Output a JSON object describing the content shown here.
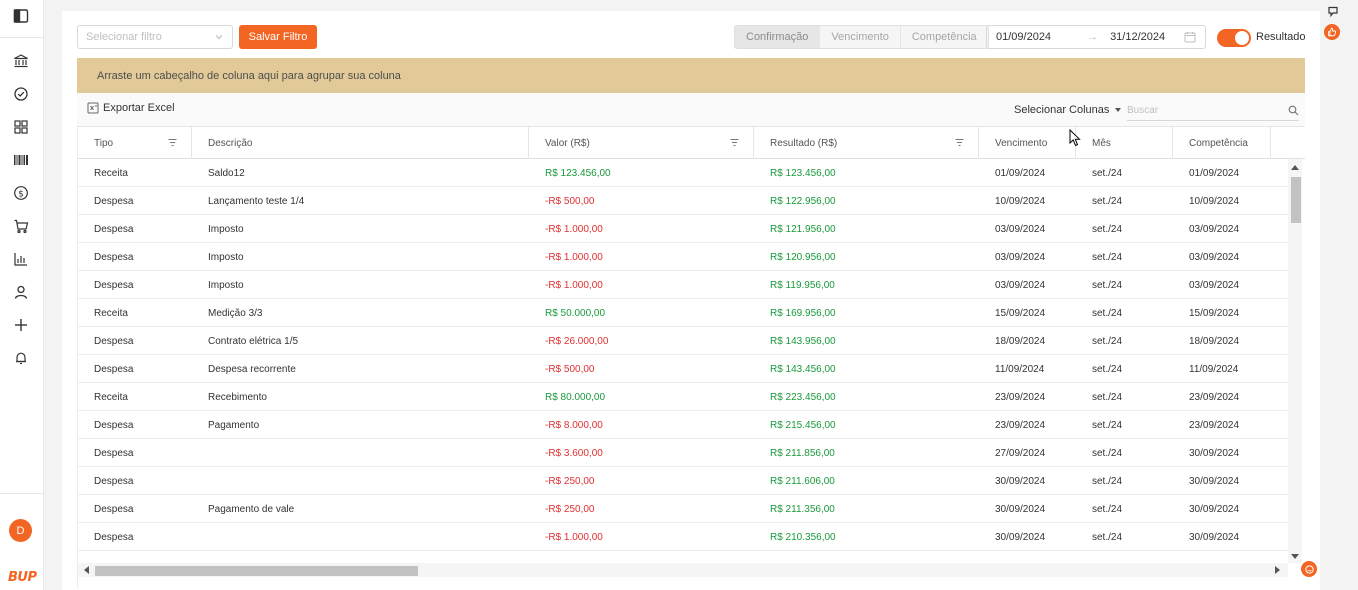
{
  "sidebar": {
    "items": [
      {
        "icon": "panel-toggle-icon"
      },
      {
        "icon": "bank-icon"
      },
      {
        "icon": "check-circle-icon"
      },
      {
        "icon": "grid-icon"
      },
      {
        "icon": "barcode-icon"
      },
      {
        "icon": "dollar-circle-icon"
      },
      {
        "icon": "cart-icon"
      },
      {
        "icon": "bar-chart-icon"
      },
      {
        "icon": "user-icon"
      },
      {
        "icon": "plus-icon"
      },
      {
        "icon": "bell-icon"
      }
    ],
    "avatar_letter": "D",
    "logo_text": "BUP"
  },
  "toolbar": {
    "filter_placeholder": "Selecionar filtro",
    "save_filter_label": "Salvar Filtro",
    "date_modes": [
      "Confirmação",
      "Vencimento",
      "Competência"
    ],
    "active_date_mode": "Confirmação",
    "date_start": "01/09/2024",
    "date_end": "31/12/2024",
    "result_toggle_label": "Resultado",
    "result_toggle_on": true
  },
  "group_panel": {
    "text": "Arraste um cabeçalho de coluna aqui para agrupar sua coluna"
  },
  "grid_toolbar": {
    "export_label": "Exportar Excel",
    "columns_label": "Selecionar Colunas",
    "search_placeholder": "Buscar"
  },
  "grid": {
    "columns": [
      "Tipo",
      "Descrição",
      "Valor (R$)",
      "Resultado (R$)",
      "Vencimento",
      "Mês",
      "Competência"
    ],
    "rows": [
      {
        "tipo": "Receita",
        "descricao": "Saldo12",
        "valor": "R$ 123.456,00",
        "valor_sign": "pos",
        "resultado": "R$ 123.456,00",
        "vencimento": "01/09/2024",
        "mes": "set./24",
        "competencia": "01/09/2024"
      },
      {
        "tipo": "Despesa",
        "descricao": "Lançamento teste 1/4",
        "valor": "-R$ 500,00",
        "valor_sign": "neg",
        "resultado": "R$ 122.956,00",
        "vencimento": "10/09/2024",
        "mes": "set./24",
        "competencia": "10/09/2024"
      },
      {
        "tipo": "Despesa",
        "descricao": "Imposto",
        "valor": "-R$ 1.000,00",
        "valor_sign": "neg",
        "resultado": "R$ 121.956,00",
        "vencimento": "03/09/2024",
        "mes": "set./24",
        "competencia": "03/09/2024"
      },
      {
        "tipo": "Despesa",
        "descricao": "Imposto",
        "valor": "-R$ 1.000,00",
        "valor_sign": "neg",
        "resultado": "R$ 120.956,00",
        "vencimento": "03/09/2024",
        "mes": "set./24",
        "competencia": "03/09/2024"
      },
      {
        "tipo": "Despesa",
        "descricao": "Imposto",
        "valor": "-R$ 1.000,00",
        "valor_sign": "neg",
        "resultado": "R$ 119.956,00",
        "vencimento": "03/09/2024",
        "mes": "set./24",
        "competencia": "03/09/2024"
      },
      {
        "tipo": "Receita",
        "descricao": "Medição 3/3",
        "valor": "R$ 50.000,00",
        "valor_sign": "pos",
        "resultado": "R$ 169.956,00",
        "vencimento": "15/09/2024",
        "mes": "set./24",
        "competencia": "15/09/2024"
      },
      {
        "tipo": "Despesa",
        "descricao": "Contrato elétrica 1/5",
        "valor": "-R$ 26.000,00",
        "valor_sign": "neg",
        "resultado": "R$ 143.956,00",
        "vencimento": "18/09/2024",
        "mes": "set./24",
        "competencia": "18/09/2024"
      },
      {
        "tipo": "Despesa",
        "descricao": "Despesa recorrente",
        "valor": "-R$ 500,00",
        "valor_sign": "neg",
        "resultado": "R$ 143.456,00",
        "vencimento": "11/09/2024",
        "mes": "set./24",
        "competencia": "11/09/2024"
      },
      {
        "tipo": "Receita",
        "descricao": "Recebimento",
        "valor": "R$ 80.000,00",
        "valor_sign": "pos",
        "resultado": "R$ 223.456,00",
        "vencimento": "23/09/2024",
        "mes": "set./24",
        "competencia": "23/09/2024"
      },
      {
        "tipo": "Despesa",
        "descricao": "Pagamento",
        "valor": "-R$ 8.000,00",
        "valor_sign": "neg",
        "resultado": "R$ 215.456,00",
        "vencimento": "23/09/2024",
        "mes": "set./24",
        "competencia": "23/09/2024"
      },
      {
        "tipo": "Despesa",
        "descricao": "",
        "valor": "-R$ 3.600,00",
        "valor_sign": "neg",
        "resultado": "R$ 211.856,00",
        "vencimento": "27/09/2024",
        "mes": "set./24",
        "competencia": "30/09/2024"
      },
      {
        "tipo": "Despesa",
        "descricao": "",
        "valor": "-R$ 250,00",
        "valor_sign": "neg",
        "resultado": "R$ 211.606,00",
        "vencimento": "30/09/2024",
        "mes": "set./24",
        "competencia": "30/09/2024"
      },
      {
        "tipo": "Despesa",
        "descricao": "Pagamento de vale",
        "valor": "-R$ 250,00",
        "valor_sign": "neg",
        "resultado": "R$ 211.356,00",
        "vencimento": "30/09/2024",
        "mes": "set./24",
        "competencia": "30/09/2024"
      },
      {
        "tipo": "Despesa",
        "descricao": "",
        "valor": "-R$ 1.000,00",
        "valor_sign": "neg",
        "resultado": "R$ 210.356,00",
        "vencimento": "30/09/2024",
        "mes": "set./24",
        "competencia": "30/09/2024"
      }
    ]
  },
  "colors": {
    "accent": "#f26522",
    "group_panel_bg": "#e2ca98",
    "positive": "#1a9a3a",
    "negative": "#e03131"
  }
}
